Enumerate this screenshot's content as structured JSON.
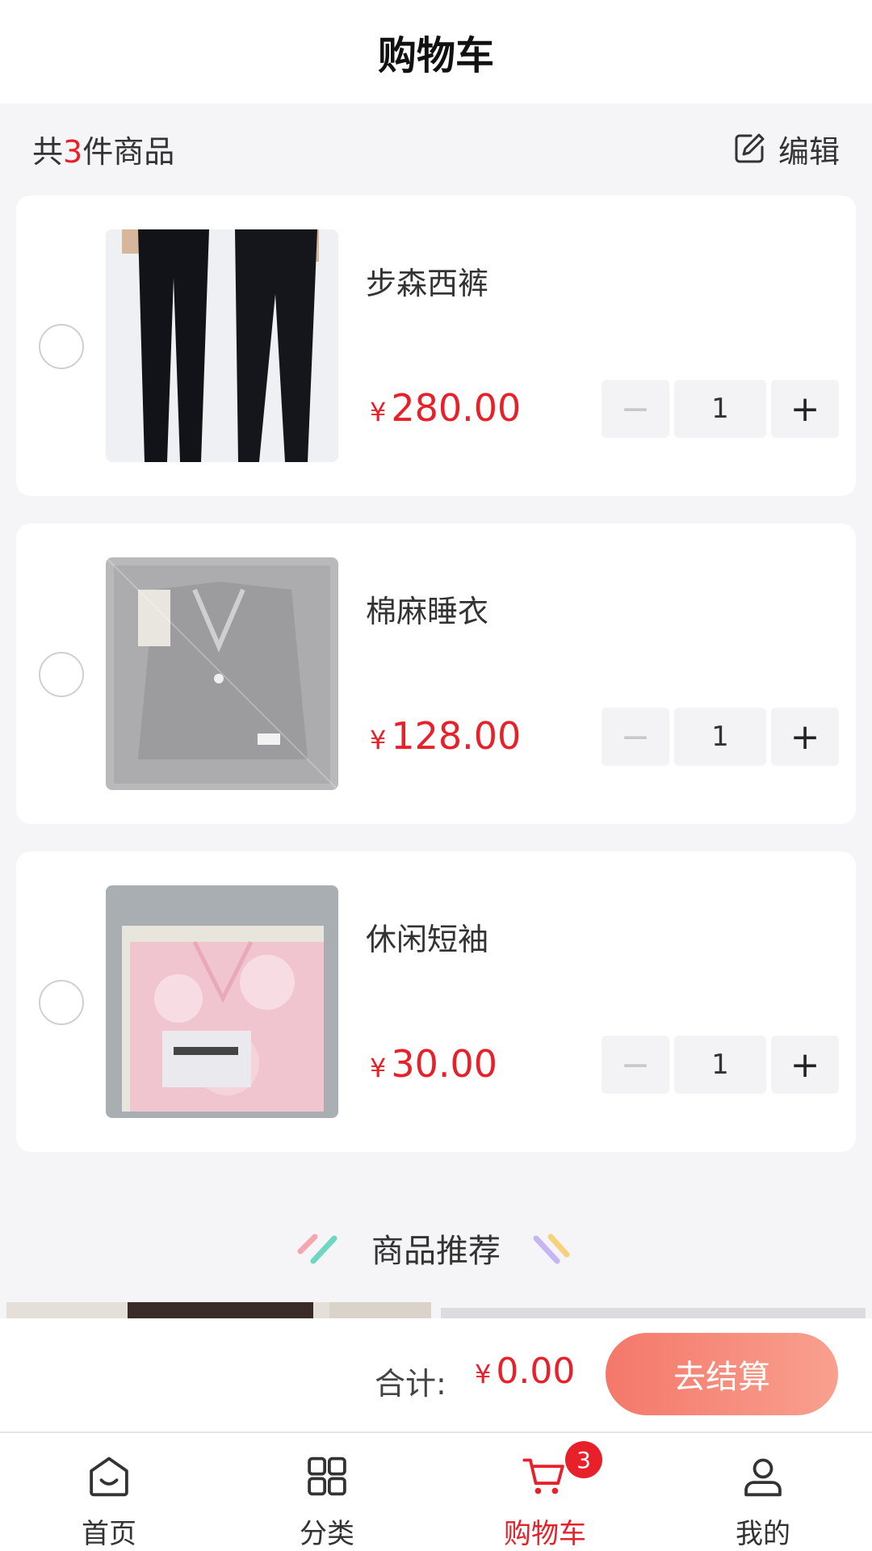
{
  "header": {
    "title": "购物车"
  },
  "summary": {
    "prefix": "共",
    "count": "3",
    "suffix": "件商品",
    "edit_label": "编辑"
  },
  "cart": {
    "items": [
      {
        "name": "步森西裤",
        "currency": "¥",
        "price": "280.00",
        "quantity": "1",
        "minus": "−",
        "plus": "+",
        "selected": false
      },
      {
        "name": "棉麻睡衣",
        "currency": "¥",
        "price": "128.00",
        "quantity": "1",
        "minus": "−",
        "plus": "+",
        "selected": false
      },
      {
        "name": "休闲短袖",
        "currency": "¥",
        "price": "30.00",
        "quantity": "1",
        "minus": "−",
        "plus": "+",
        "selected": false
      }
    ]
  },
  "recommend": {
    "title": "商品推荐"
  },
  "checkout": {
    "total_label": "合计:",
    "currency": "¥",
    "total": "0.00",
    "button_label": "去结算"
  },
  "tabbar": {
    "tabs": [
      {
        "label": "首页",
        "icon": "home-icon",
        "active": false
      },
      {
        "label": "分类",
        "icon": "grid-icon",
        "active": false
      },
      {
        "label": "购物车",
        "icon": "cart-icon",
        "active": true,
        "badge": "3"
      },
      {
        "label": "我的",
        "icon": "user-icon",
        "active": false
      }
    ]
  },
  "colors": {
    "accent": "#e8202a",
    "checkout_gradient_start": "#f4786a",
    "checkout_gradient_end": "#f9a08f",
    "background": "#f5f4f7"
  }
}
